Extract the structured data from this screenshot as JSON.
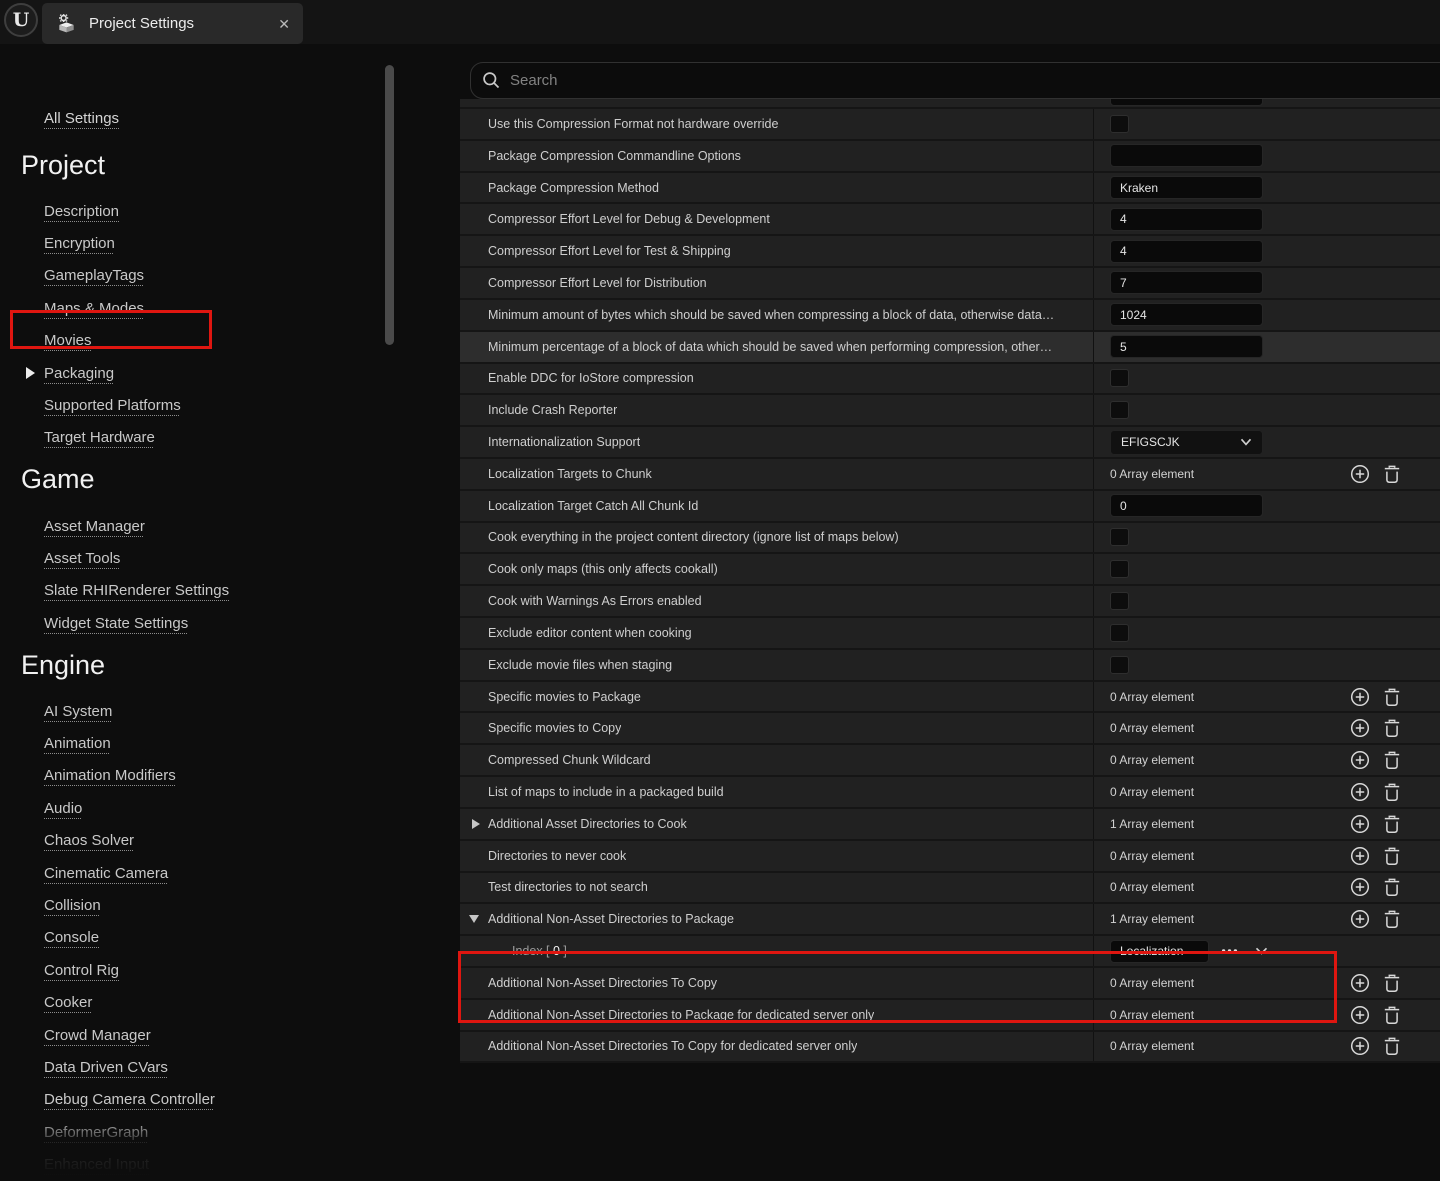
{
  "window": {
    "tab_title": "Project Settings",
    "close_glyph": "✕",
    "logo_glyph": "U"
  },
  "colors": {
    "annotation_red": "#df1610"
  },
  "sidebar": {
    "all_settings": "All Settings",
    "sections": [
      {
        "title": "Project",
        "items": [
          {
            "label": "Description"
          },
          {
            "label": "Encryption"
          },
          {
            "label": "GameplayTags"
          },
          {
            "label": "Maps & Modes"
          },
          {
            "label": "Movies"
          },
          {
            "label": "Packaging",
            "selected": true
          },
          {
            "label": "Supported Platforms"
          },
          {
            "label": "Target Hardware"
          }
        ]
      },
      {
        "title": "Game",
        "items": [
          {
            "label": "Asset Manager"
          },
          {
            "label": "Asset Tools"
          },
          {
            "label": "Slate RHIRenderer Settings"
          },
          {
            "label": "Widget State Settings"
          }
        ]
      },
      {
        "title": "Engine",
        "items": [
          {
            "label": "AI System"
          },
          {
            "label": "Animation"
          },
          {
            "label": "Animation Modifiers"
          },
          {
            "label": "Audio"
          },
          {
            "label": "Chaos Solver"
          },
          {
            "label": "Cinematic Camera"
          },
          {
            "label": "Collision"
          },
          {
            "label": "Console"
          },
          {
            "label": "Control Rig"
          },
          {
            "label": "Cooker"
          },
          {
            "label": "Crowd Manager"
          },
          {
            "label": "Data Driven CVars"
          },
          {
            "label": "Debug Camera Controller"
          },
          {
            "label": "DeformerGraph"
          },
          {
            "label": "Enhanced Input"
          }
        ]
      }
    ]
  },
  "search": {
    "placeholder": "Search"
  },
  "rows": [
    {
      "label": "Use this Compression Format not hardware override",
      "control": "checkbox"
    },
    {
      "label": "Package Compression Commandline Options",
      "control": "input",
      "value": ""
    },
    {
      "label": "Package Compression Method",
      "control": "input",
      "value": "Kraken"
    },
    {
      "label": "Compressor Effort Level for Debug & Development",
      "control": "input",
      "value": "4"
    },
    {
      "label": "Compressor Effort Level for Test & Shipping",
      "control": "input",
      "value": "4"
    },
    {
      "label": "Compressor Effort Level for Distribution",
      "control": "input",
      "value": "7"
    },
    {
      "label": "Minimum amount of bytes which should be saved when compressing a block of data, otherwise data…",
      "control": "input",
      "value": "1024"
    },
    {
      "label": "Minimum percentage of a block of data which should be saved when performing compression, other…",
      "control": "input",
      "value": "5",
      "highlighted": true
    },
    {
      "label": "Enable DDC for IoStore compression",
      "control": "checkbox"
    },
    {
      "label": "Include Crash Reporter",
      "control": "checkbox"
    },
    {
      "label": "Internationalization Support",
      "control": "dropdown",
      "value": "EFIGSCJK"
    },
    {
      "label": "Localization Targets to Chunk",
      "control": "array",
      "count_label": "0 Array element"
    },
    {
      "label": "Localization Target Catch All Chunk Id",
      "control": "input",
      "value": "0"
    },
    {
      "label": "Cook everything in the project content directory (ignore list of maps below)",
      "control": "checkbox"
    },
    {
      "label": "Cook only maps (this only affects cookall)",
      "control": "checkbox"
    },
    {
      "label": "Cook with Warnings As Errors enabled",
      "control": "checkbox"
    },
    {
      "label": "Exclude editor content when cooking",
      "control": "checkbox"
    },
    {
      "label": "Exclude movie files when staging",
      "control": "checkbox"
    },
    {
      "label": "Specific movies to Package",
      "control": "array",
      "count_label": "0 Array element"
    },
    {
      "label": "Specific movies to Copy",
      "control": "array",
      "count_label": "0 Array element"
    },
    {
      "label": "Compressed Chunk Wildcard",
      "control": "array",
      "count_label": "0 Array element"
    },
    {
      "label": "List of maps to include in a packaged build",
      "control": "array",
      "count_label": "0 Array element"
    },
    {
      "label": "Additional Asset Directories to Cook",
      "control": "array",
      "count_label": "1 Array element",
      "expander": "collapsed"
    },
    {
      "label": "Directories to never cook",
      "control": "array",
      "count_label": "0 Array element"
    },
    {
      "label": "Test directories to not search",
      "control": "array",
      "count_label": "0 Array element"
    },
    {
      "label": "Additional Non-Asset Directories to Package",
      "control": "array",
      "count_label": "1 Array element",
      "expander": "expanded"
    },
    {
      "control": "index",
      "indent": true,
      "index_label": {
        "pre": "Index [ ",
        "num": "0",
        "post": " ]"
      },
      "value": "Localization"
    },
    {
      "label": "Additional Non-Asset Directories To Copy",
      "control": "array",
      "count_label": "0 Array element"
    },
    {
      "label": "Additional Non-Asset Directories to Package for dedicated server only",
      "control": "array",
      "count_label": "0 Array element"
    },
    {
      "label": "Additional Non-Asset Directories To Copy for dedicated server only",
      "control": "array",
      "count_label": "0 Array element"
    }
  ]
}
